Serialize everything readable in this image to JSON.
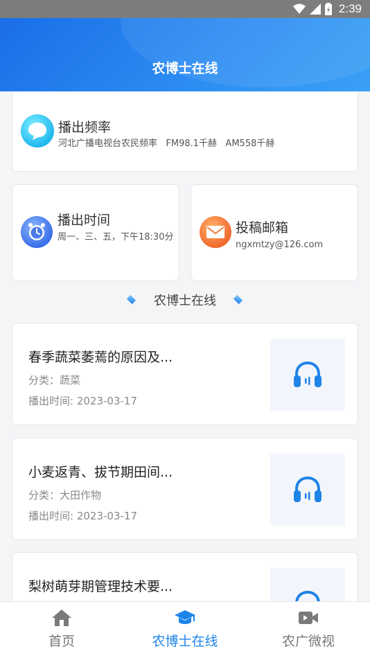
{
  "status_bar": {
    "time": "2:39"
  },
  "header": {
    "title": "农博士在线"
  },
  "info": {
    "frequency": {
      "title": "播出频率",
      "detail": "河北广播电视台农民频率   FM98.1千赫   AM558千赫"
    },
    "time": {
      "title": "播出时间",
      "detail": "周一、三、五，下午18:30分"
    },
    "email": {
      "title": "投稿邮箱",
      "detail": "ngxmtzy@126.com"
    }
  },
  "section": {
    "title": "农博士在线"
  },
  "programs": [
    {
      "title": "春季蔬菜萎蔫的原因及...",
      "category": "分类：蔬菜",
      "date": "播出时间: 2023-03-17"
    },
    {
      "title": "小麦返青、拔节期田间...",
      "category": "分类：大田作物",
      "date": "播出时间: 2023-03-17"
    },
    {
      "title": "梨树萌芽期管理技术要..."
    }
  ],
  "tabs": [
    {
      "label": "首页",
      "icon": "home-icon"
    },
    {
      "label": "农博士在线",
      "icon": "graduation-cap-icon",
      "active": true
    },
    {
      "label": "农广微视",
      "icon": "video-camera-icon"
    }
  ],
  "colors": {
    "accent": "#1f84e8",
    "header": "#2288ee"
  }
}
